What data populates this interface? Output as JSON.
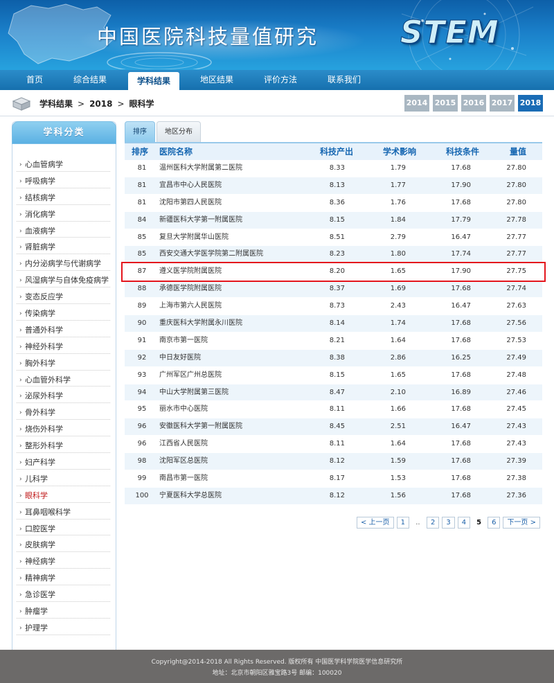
{
  "header": {
    "site_title": "中国医院科技量值研究",
    "logo_text": "STEM"
  },
  "nav": {
    "tabs": [
      {
        "label": "首页",
        "active": false
      },
      {
        "label": "综合结果",
        "active": false
      },
      {
        "label": "学科结果",
        "active": true
      },
      {
        "label": "地区结果",
        "active": false
      },
      {
        "label": "评价方法",
        "active": false
      },
      {
        "label": "联系我们",
        "active": false
      }
    ]
  },
  "breadcrumb": {
    "items": [
      "学科结果",
      "2018",
      "眼科学"
    ],
    "separator": ">"
  },
  "years": {
    "options": [
      "2014",
      "2015",
      "2016",
      "2017",
      "2018"
    ],
    "selected": "2018"
  },
  "sidebar": {
    "title": "学科分类",
    "items": [
      "心血管病学",
      "呼吸病学",
      "结核病学",
      "消化病学",
      "血液病学",
      "肾脏病学",
      "内分泌病学与代谢病学",
      "风湿病学与自体免疫病学",
      "变态反应学",
      "传染病学",
      "普通外科学",
      "神经外科学",
      "胸外科学",
      "心血管外科学",
      "泌尿外科学",
      "骨外科学",
      "烧伤外科学",
      "整形外科学",
      "妇产科学",
      "儿科学",
      "眼科学",
      "耳鼻咽喉科学",
      "口腔医学",
      "皮肤病学",
      "神经病学",
      "精神病学",
      "急诊医学",
      "肿瘤学",
      "护理学"
    ],
    "active_item": "眼科学"
  },
  "content_tabs": [
    {
      "label": "排序",
      "active": true
    },
    {
      "label": "地区分布",
      "active": false
    }
  ],
  "table": {
    "headers": [
      "排序",
      "医院名称",
      "科技产出",
      "学术影响",
      "科技条件",
      "量值"
    ],
    "rows": [
      [
        "81",
        "温州医科大学附属第二医院",
        "8.33",
        "1.79",
        "17.68",
        "27.80"
      ],
      [
        "81",
        "宜昌市中心人民医院",
        "8.13",
        "1.77",
        "17.90",
        "27.80"
      ],
      [
        "81",
        "沈阳市第四人民医院",
        "8.36",
        "1.76",
        "17.68",
        "27.80"
      ],
      [
        "84",
        "新疆医科大学第一附属医院",
        "8.15",
        "1.84",
        "17.79",
        "27.78"
      ],
      [
        "85",
        "复旦大学附属华山医院",
        "8.51",
        "2.79",
        "16.47",
        "27.77"
      ],
      [
        "85",
        "西安交通大学医学院第二附属医院",
        "8.23",
        "1.80",
        "17.74",
        "27.77"
      ],
      [
        "87",
        "遵义医学院附属医院",
        "8.20",
        "1.65",
        "17.90",
        "27.75"
      ],
      [
        "88",
        "承德医学院附属医院",
        "8.37",
        "1.69",
        "17.68",
        "27.74"
      ],
      [
        "89",
        "上海市第六人民医院",
        "8.73",
        "2.43",
        "16.47",
        "27.63"
      ],
      [
        "90",
        "重庆医科大学附属永川医院",
        "8.14",
        "1.74",
        "17.68",
        "27.56"
      ],
      [
        "91",
        "南京市第一医院",
        "8.21",
        "1.64",
        "17.68",
        "27.53"
      ],
      [
        "92",
        "中日友好医院",
        "8.38",
        "2.86",
        "16.25",
        "27.49"
      ],
      [
        "93",
        "广州军区广州总医院",
        "8.15",
        "1.65",
        "17.68",
        "27.48"
      ],
      [
        "94",
        "中山大学附属第三医院",
        "8.47",
        "2.10",
        "16.89",
        "27.46"
      ],
      [
        "95",
        "丽水市中心医院",
        "8.11",
        "1.66",
        "17.68",
        "27.45"
      ],
      [
        "96",
        "安徽医科大学第一附属医院",
        "8.45",
        "2.51",
        "16.47",
        "27.43"
      ],
      [
        "96",
        "江西省人民医院",
        "8.11",
        "1.64",
        "17.68",
        "27.43"
      ],
      [
        "98",
        "沈阳军区总医院",
        "8.12",
        "1.59",
        "17.68",
        "27.39"
      ],
      [
        "99",
        "南昌市第一医院",
        "8.17",
        "1.53",
        "17.68",
        "27.38"
      ],
      [
        "100",
        "宁夏医科大学总医院",
        "8.12",
        "1.56",
        "17.68",
        "27.36"
      ]
    ],
    "highlighted_row": 6
  },
  "pagination": {
    "prev_label": "< 上一页",
    "next_label": "下一页 >",
    "first_page": "1",
    "ellipsis": "..",
    "pages": [
      "2",
      "3",
      "4",
      "5",
      "6"
    ],
    "current": "5"
  },
  "footer": {
    "copyright": "Copyright@2014-2018 All Rights Reserved. 版权所有 中国医学科学院医学信息研究所",
    "address": "地址：北京市朝阳区雅宝路3号 邮编：100020"
  },
  "colors": {
    "banner": "#1a7fc9",
    "nav": "#1670ae",
    "accent": "#1a6cb5",
    "header_text": "#1566b1",
    "highlight_border": "#e4151c",
    "active_sidebar_text": "#c01a1a",
    "footer": "#6c6a69"
  }
}
